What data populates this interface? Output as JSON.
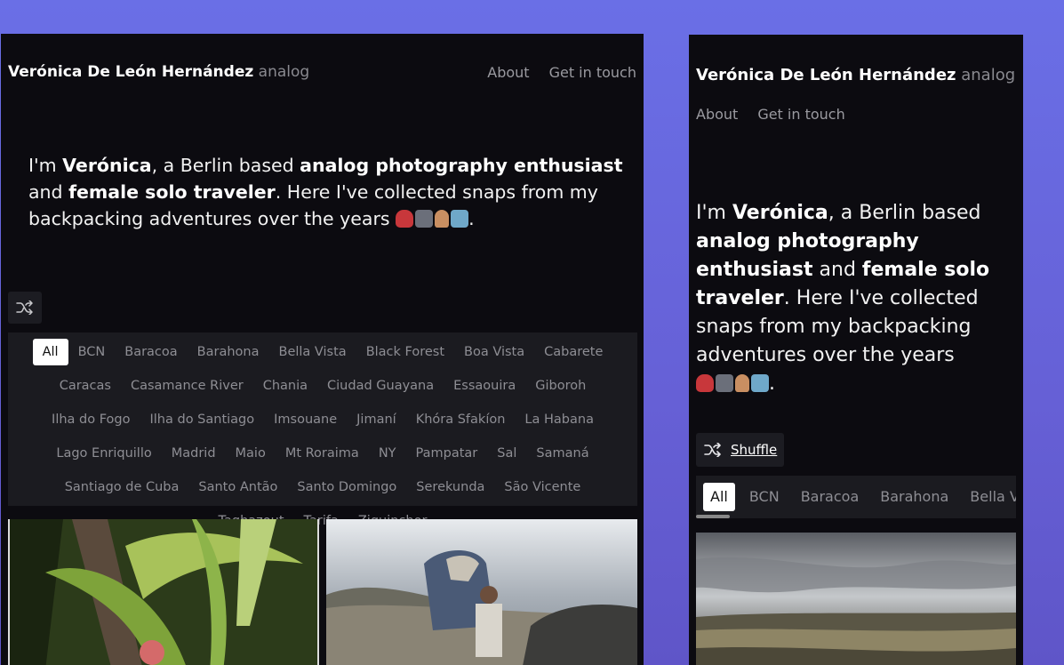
{
  "site": {
    "name": "Verónica De León Hernández",
    "subtitle": "analog"
  },
  "nav": {
    "about": "About",
    "contact": "Get in touch"
  },
  "intro": {
    "t1": "I'm ",
    "b1": "Verónica",
    "t2": ", a Berlin based ",
    "b2": "analog photography enthusiast",
    "t3": " and ",
    "b3": "female solo traveler",
    "t4": ". Here I've collected snaps from my backpacking adventures over the years ",
    "t5": ".",
    "emojis": [
      "backpack",
      "camera-with-flash",
      "victory-hand",
      "world-map"
    ]
  },
  "shuffle": {
    "label": "Shuffle",
    "icon": "shuffle-icon"
  },
  "filters": [
    "All",
    "BCN",
    "Baracoa",
    "Barahona",
    "Bella Vista",
    "Black Forest",
    "Boa Vista",
    "Cabarete",
    "Caracas",
    "Casamance River",
    "Chania",
    "Ciudad Guayana",
    "Essaouira",
    "Giboroh",
    "Ilha do Fogo",
    "Ilha do Santiago",
    "Imsouane",
    "Jimaní",
    "Khóra Sfakíon",
    "La Habana",
    "Lago Enriquillo",
    "Madrid",
    "Maio",
    "Mt Roraima",
    "NY",
    "Pampatar",
    "Sal",
    "Samaná",
    "Santiago de Cuba",
    "Santo Antão",
    "Santo Domingo",
    "Serekunda",
    "São Vicente",
    "Taghazout",
    "Tarifa",
    "Ziguinchor"
  ],
  "active_filter": "All",
  "mobile_filters": [
    "All",
    "BCN",
    "Baracoa",
    "Barahona",
    "Bella Vista"
  ],
  "colors": {
    "background_gradient_top": "#6a6fe6",
    "frame_bg": "#0c0b10",
    "panel_bg": "#1b1b20",
    "muted_text": "#8e8e94"
  }
}
